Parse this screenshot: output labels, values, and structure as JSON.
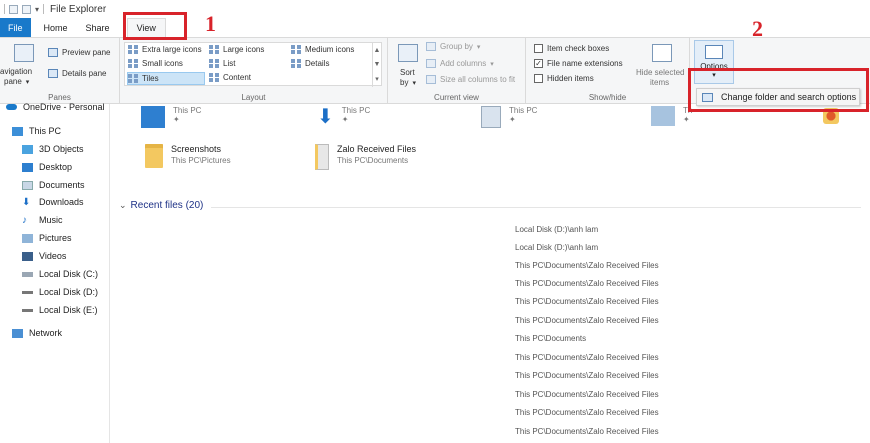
{
  "window": {
    "title": "File Explorer"
  },
  "tabs": [
    "File",
    "Home",
    "Share",
    "View"
  ],
  "ribbon": {
    "panes": {
      "preview_pane": "Preview pane",
      "navigation_pane_1": "avigation",
      "navigation_pane_2": "pane",
      "details_pane": "Details pane",
      "label": "Panes"
    },
    "layout": {
      "items": [
        "Extra large icons",
        "Large icons",
        "Medium icons",
        "Small icons",
        "List",
        "Details",
        "Tiles",
        "Content"
      ],
      "label": "Layout"
    },
    "current_view": {
      "sort_by_1": "Sort",
      "sort_by_2": "by",
      "group_by": "Group by",
      "add_columns": "Add columns",
      "size_all": "Size all columns to fit",
      "label": "Current view"
    },
    "show_hide": {
      "item_check_boxes": "Item check boxes",
      "file_name_extensions": "File name extensions",
      "hidden_items": "Hidden items",
      "hide_selected_1": "Hide selected",
      "hide_selected_2": "items",
      "label": "Show/hide"
    },
    "options_label": "Options",
    "dropdown_item": "Change folder and search options"
  },
  "annotations": {
    "step1": "1",
    "step2": "2"
  },
  "nav": {
    "onedrive": "OneDrive - Personal",
    "items": [
      "This PC",
      "3D Objects",
      "Desktop",
      "Documents",
      "Downloads",
      "Music",
      "Pictures",
      "Videos",
      "Local Disk (C:)",
      "Local Disk (D:)",
      "Local Disk (E:)",
      "Network"
    ]
  },
  "quick_access": {
    "top_row": [
      "This PC",
      "This PC",
      "This PC",
      "Th"
    ],
    "tiles": [
      {
        "name": "Screenshots",
        "path": "This PC\\Pictures"
      },
      {
        "name": "Zalo Received Files",
        "path": "This PC\\Documents"
      }
    ]
  },
  "recent": {
    "header": "Recent files (20)",
    "paths": [
      "Local Disk (D:)\\anh lam",
      "Local Disk (D:)\\anh lam",
      "This PC\\Documents\\Zalo Received Files",
      "This PC\\Documents\\Zalo Received Files",
      "This PC\\Documents\\Zalo Received Files",
      "This PC\\Documents\\Zalo Received Files",
      "This PC\\Documents",
      "This PC\\Documents\\Zalo Received Files",
      "This PC\\Documents\\Zalo Received Files",
      "This PC\\Documents\\Zalo Received Files",
      "This PC\\Documents\\Zalo Received Files",
      "This PC\\Documents\\Zalo Received Files"
    ]
  }
}
